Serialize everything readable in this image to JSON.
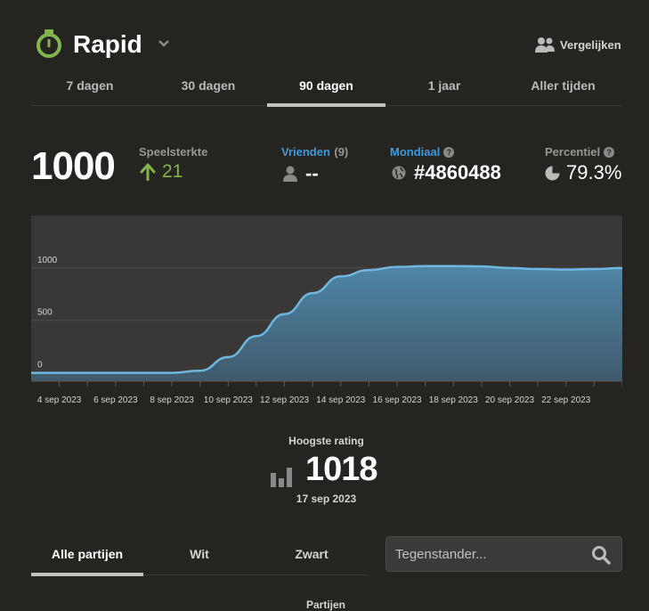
{
  "header": {
    "title": "Rapid",
    "compare_label": "Vergelijken"
  },
  "tabs": [
    {
      "label": "7 dagen",
      "active": false
    },
    {
      "label": "30 dagen",
      "active": false
    },
    {
      "label": "90 dagen",
      "active": true
    },
    {
      "label": "1 jaar",
      "active": false
    },
    {
      "label": "Aller tijden",
      "active": false
    }
  ],
  "stats": {
    "rating": "1000",
    "strength_label": "Speelsterkte",
    "strength_change": "21",
    "friends_label": "Vrienden",
    "friends_count": "(9)",
    "friends_value": "--",
    "global_label": "Mondiaal",
    "global_value": "#4860488",
    "percentile_label": "Percentiel",
    "percentile_value": "79.3%",
    "help_glyph": "?"
  },
  "chart_data": {
    "type": "area",
    "x": [
      "2023-09-03",
      "2023-09-04",
      "2023-09-05",
      "2023-09-06",
      "2023-09-07",
      "2023-09-08",
      "2023-09-09",
      "2023-09-10",
      "2023-09-11",
      "2023-09-12",
      "2023-09-13",
      "2023-09-14",
      "2023-09-15",
      "2023-09-16",
      "2023-09-17",
      "2023-09-18",
      "2023-09-19",
      "2023-09-20",
      "2023-09-21",
      "2023-09-22",
      "2023-09-23",
      "2023-09-24"
    ],
    "series": [
      {
        "values": [
          0,
          0,
          0,
          0,
          0,
          0,
          20,
          150,
          350,
          560,
          760,
          920,
          980,
          1010,
          1018,
          1018,
          1015,
          1000,
          990,
          985,
          990,
          1000
        ]
      }
    ],
    "x_tick_labels": [
      "4 sep 2023",
      "6 sep 2023",
      "8 sep 2023",
      "10 sep 2023",
      "12 sep 2023",
      "14 sep 2023",
      "16 sep 2023",
      "18 sep 2023",
      "20 sep 2023",
      "22 sep 2023"
    ],
    "y_tick_labels": [
      "1000",
      "500",
      "0"
    ],
    "y_ticks": [
      1000,
      500,
      0
    ],
    "ylim": [
      -80,
      1500
    ],
    "grid": true,
    "color": "#5a9fc7"
  },
  "best": {
    "label": "Hoogste rating",
    "value": "1018",
    "date": "17 sep 2023"
  },
  "games_tabs": [
    {
      "label": "Alle partijen",
      "active": true
    },
    {
      "label": "Wit",
      "active": false
    },
    {
      "label": "Zwart",
      "active": false
    }
  ],
  "search": {
    "placeholder": "Tegenstander..."
  },
  "games_header": "Partijen",
  "colors": {
    "accent_green": "#81b64c",
    "accent_blue": "#3c9ae0",
    "background": "#262421"
  }
}
